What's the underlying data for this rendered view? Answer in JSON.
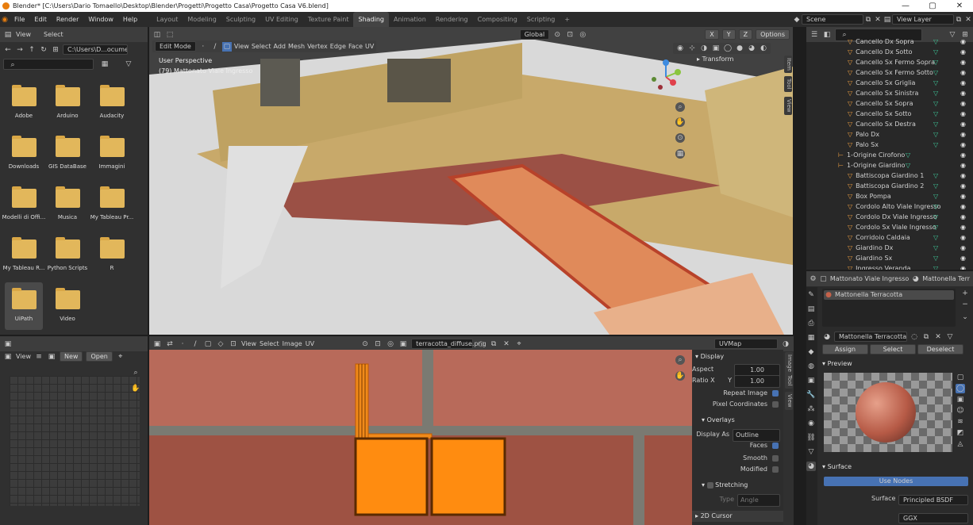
{
  "window": {
    "title": "Blender* [C:\\Users\\Dario Tomaello\\Desktop\\Blender\\Progetti\\Progetto Casa\\Progetto Casa V6.blend]",
    "min": "—",
    "max": "▢",
    "close": "✕"
  },
  "menu": [
    "File",
    "Edit",
    "Render",
    "Window",
    "Help"
  ],
  "workspaces": [
    "Layout",
    "Modeling",
    "Sculpting",
    "UV Editing",
    "Texture Paint",
    "Shading",
    "Animation",
    "Rendering",
    "Compositing",
    "Scripting",
    "+"
  ],
  "active_workspace": "Shading",
  "scene": {
    "name": "Scene",
    "view_layer": "View Layer"
  },
  "file_browser": {
    "menus": [
      "View",
      "Select"
    ],
    "path": "C:\\Users\\D...ocuments\\",
    "folders": [
      "Adobe",
      "Arduino",
      "Audacity",
      "Downloads",
      "GIS DataBase",
      "Immagini",
      "Modelli di Offi...",
      "Musica",
      "My Tableau Pr...",
      "My Tableau R...",
      "Python Scripts",
      "R",
      "UiPath",
      "Video"
    ],
    "selected": "UiPath"
  },
  "left_bottom": {
    "view": "View",
    "new": "New",
    "open": "Open"
  },
  "viewport": {
    "mode": "Edit Mode",
    "menus": [
      "View",
      "Select",
      "Add",
      "Mesh",
      "Vertex",
      "Edge",
      "Face",
      "UV"
    ],
    "orientation": "Global",
    "options": "Options",
    "info1": "User Perspective",
    "info2": "(79) Mattonato Viale Ingresso",
    "xyz": [
      "X",
      "Y",
      "Z"
    ],
    "side_tabs": [
      "Item",
      "Tool",
      "View"
    ],
    "transform": "Transform"
  },
  "uv_editor": {
    "menus": [
      "View",
      "Select",
      "Image",
      "UV"
    ],
    "image": "terracotta_diffuse.png",
    "uvmap": "UVMap",
    "side_tabs": [
      "Image",
      "Tool",
      "View"
    ],
    "image_panel": {
      "title": "Display",
      "aspect_x_label": "Aspect Ratio X",
      "aspect_x": "1.00",
      "aspect_y_label": "Y",
      "aspect_y": "1.00",
      "repeat": "Repeat Image",
      "pixel": "Pixel Coordinates"
    },
    "overlays": {
      "title": "Overlays",
      "display_as_label": "Display As",
      "display_as": "Outline",
      "faces": "Faces",
      "smooth": "Smooth",
      "modified": "Modified",
      "stretching": "Stretching",
      "type_label": "Type",
      "type": "Angle",
      "cursor": "2D Cursor"
    }
  },
  "outliner": {
    "rows": [
      {
        "name": "Cancello Dx Sopra",
        "indent": 1
      },
      {
        "name": "Cancello Dx Sotto",
        "indent": 1
      },
      {
        "name": "Cancello Sx Fermo Sopra",
        "indent": 1
      },
      {
        "name": "Cancello Sx Fermo Sotto",
        "indent": 1
      },
      {
        "name": "Cancello Sx Griglia",
        "indent": 1
      },
      {
        "name": "Cancello Sx Sinistra",
        "indent": 1
      },
      {
        "name": "Cancello Sx Sopra",
        "indent": 1
      },
      {
        "name": "Cancello Sx Sotto",
        "indent": 1
      },
      {
        "name": "Cancello Sx Destra",
        "indent": 1
      },
      {
        "name": "Palo Dx",
        "indent": 1
      },
      {
        "name": "Palo Sx",
        "indent": 1
      },
      {
        "name": "1-Origine Cirofono",
        "indent": 0
      },
      {
        "name": "1-Origine Giardino",
        "indent": 0
      },
      {
        "name": "Battiscopa Giardino 1",
        "indent": 1
      },
      {
        "name": "Battiscopa Giardino 2",
        "indent": 1
      },
      {
        "name": "Box Pompa",
        "indent": 1
      },
      {
        "name": "Cordolo Alto Viale Ingresso",
        "indent": 1
      },
      {
        "name": "Cordolo Dx Viale Ingresso",
        "indent": 1
      },
      {
        "name": "Cordolo Sx Viale Ingresso",
        "indent": 1
      },
      {
        "name": "Corridoio Caldaia",
        "indent": 1
      },
      {
        "name": "Giardino Dx",
        "indent": 1
      },
      {
        "name": "Giardino Sx",
        "indent": 1
      },
      {
        "name": "Ingresso Veranda",
        "indent": 1
      }
    ]
  },
  "properties": {
    "object": "Mattonato Viale Ingresso",
    "material_tab": "Mattonella Terr",
    "slot": "Mattonella Terracotta",
    "material": "Mattonella Terracotta",
    "assign": "Assign",
    "select": "Select",
    "deselect": "Deselect",
    "preview": "Preview",
    "surface_title": "Surface",
    "use_nodes": "Use Nodes",
    "surface_label": "Surface",
    "surface": "Principled BSDF",
    "dist": "GGX"
  }
}
